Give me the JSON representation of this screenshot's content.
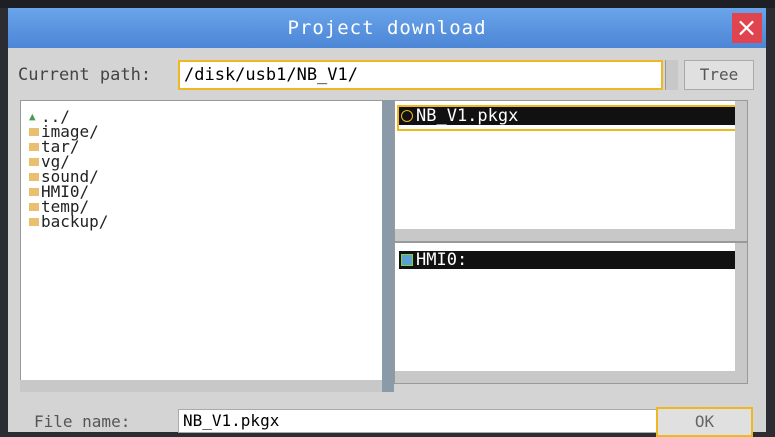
{
  "window": {
    "title": "Project download",
    "close_glyph": "×"
  },
  "path": {
    "label": "Current path:",
    "value": "/disk/usb1/NB_V1/",
    "tree_label": "Tree"
  },
  "directories": [
    {
      "name": "../",
      "icon": "up-arrow-icon"
    },
    {
      "name": "image/",
      "icon": "folder-icon"
    },
    {
      "name": "tar/",
      "icon": "folder-icon"
    },
    {
      "name": "vg/",
      "icon": "folder-icon"
    },
    {
      "name": "sound/",
      "icon": "folder-icon"
    },
    {
      "name": "HMI0/",
      "icon": "folder-icon"
    },
    {
      "name": "temp/",
      "icon": "folder-icon"
    },
    {
      "name": "backup/",
      "icon": "folder-icon"
    }
  ],
  "files": {
    "selected": "NB_V1.pkgx"
  },
  "targets": {
    "selected": "HMI0:"
  },
  "footer": {
    "filename_label": "File name:",
    "filename_value": "NB_V1.pkgx",
    "ok_label": "OK"
  },
  "colors": {
    "titlebar": "#5a96e0",
    "close": "#e0454f",
    "highlight": "#f0b820",
    "selection": "#111111"
  }
}
